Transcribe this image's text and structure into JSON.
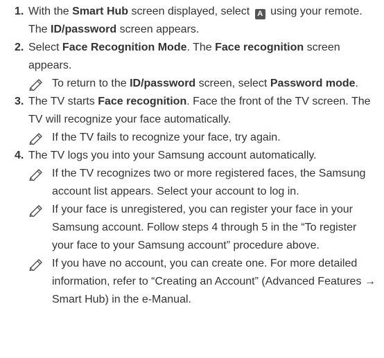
{
  "steps": [
    {
      "num": "1.",
      "t1": "With the ",
      "b1": "Smart Hub",
      "t2": " screen displayed, select ",
      "button_letter": "A",
      "t3": " using your remote. The ",
      "b2": "ID/password",
      "t4": " screen appears."
    },
    {
      "num": "2.",
      "t1": "Select ",
      "b1": "Face Recognition Mode",
      "t2": ". The ",
      "b2": "Face recognition",
      "t3": " screen appears.",
      "note": {
        "t1": "To return to the ",
        "b1": "ID/password",
        "t2": " screen, select ",
        "b2": "Password mode",
        "t3": "."
      }
    },
    {
      "num": "3.",
      "t1": "The TV starts ",
      "b1": "Face recognition",
      "t2": ". Face the front of the TV screen. The TV will recognize your face automatically.",
      "note": {
        "t1": "If the TV fails to recognize your face, try again."
      }
    },
    {
      "num": "4.",
      "t1": "The TV logs you into your Samsung account automatically.",
      "notes": [
        "If the TV recognizes two or more registered faces, the Samsung account list appears. Select your account to log in.",
        "If your face is unregistered, you can register your face in your Samsung account. Follow steps 4 through 5 in the “To register your face to your Samsung account” procedure above.",
        "If you have no account, you can create one. For more detailed information, refer to “Creating an Account” (Advanced Features → Smart Hub) in the e-Manual."
      ]
    }
  ],
  "icons": {
    "note": "pencil-note-icon",
    "button": "a-button-icon"
  },
  "colors": {
    "text": "#333333",
    "button_bg": "#555555"
  }
}
